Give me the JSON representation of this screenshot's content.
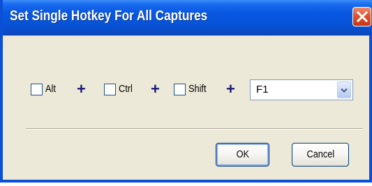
{
  "window": {
    "title": "Set Single Hotkey For All Captures",
    "close_icon": "close-icon",
    "accent_color": "#0a4fd6",
    "close_color": "#d8482a"
  },
  "modifiers": [
    {
      "label": "Alt",
      "checked": false
    },
    {
      "label": "Ctrl",
      "checked": false
    },
    {
      "label": "Shift",
      "checked": false
    }
  ],
  "plus_sign": "+",
  "key_select": {
    "value": "F1",
    "icon": "chevron-down-icon"
  },
  "buttons": {
    "ok_label": "OK",
    "cancel_label": "Cancel"
  }
}
